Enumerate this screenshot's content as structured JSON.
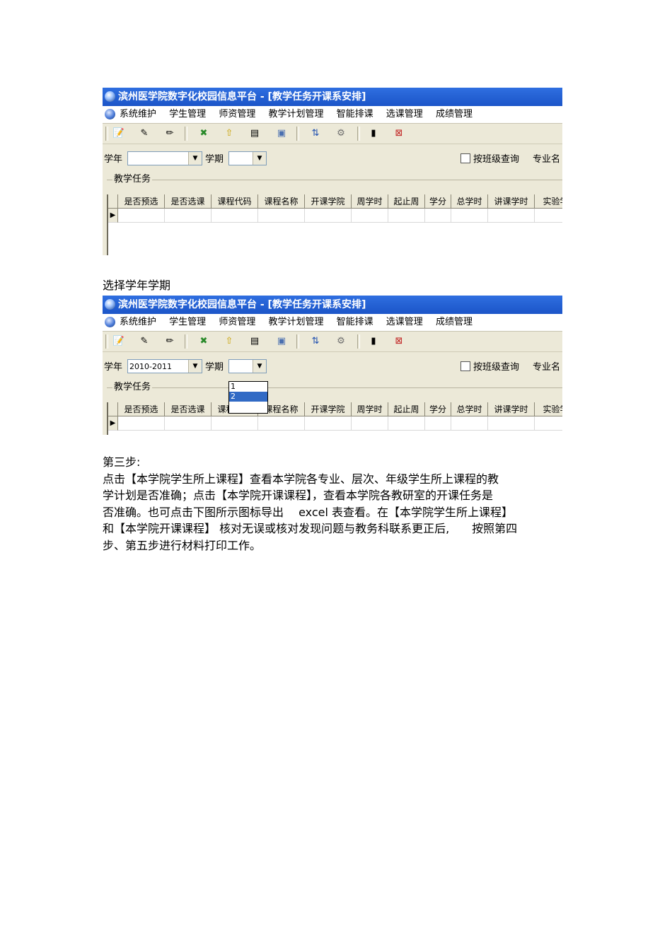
{
  "screenshot1": {
    "title": "滨州医学院数字化校园信息平台 - [教学任务开课系安排]",
    "menu": [
      "系统维护",
      "学生管理",
      "师资管理",
      "教学计划管理",
      "智能排课",
      "选课管理",
      "成绩管理"
    ],
    "filters": {
      "year_label": "学年",
      "year_value": "",
      "term_label": "学期",
      "term_value": "",
      "class_query_label": "按班级查询",
      "major_label": "专业名"
    },
    "group_label": "教学任务",
    "columns": [
      "是否预选",
      "是否选课",
      "课程代码",
      "课程名称",
      "开课学院",
      "周学时",
      "起止周",
      "学分",
      "总学时",
      "讲课学时",
      "实验学"
    ]
  },
  "caption": "选择学年学期",
  "screenshot2": {
    "title": "滨州医学院数字化校园信息平台 - [教学任务开课系安排]",
    "menu": [
      "系统维护",
      "学生管理",
      "师资管理",
      "教学计划管理",
      "智能排课",
      "选课管理",
      "成绩管理"
    ],
    "filters": {
      "year_label": "学年",
      "year_value": "2010-2011",
      "term_label": "学期",
      "term_value": "",
      "class_query_label": "按班级查询",
      "major_label": "专业名"
    },
    "term_options": [
      "1",
      "2"
    ],
    "term_selected": "2",
    "group_label": "教学任务",
    "columns": [
      "是否预选",
      "是否选课",
      "课程代码",
      "课程名称",
      "开课学院",
      "周学时",
      "起止周",
      "学分",
      "总学时",
      "讲课学时",
      "实验学"
    ]
  },
  "step": {
    "heading": "第三步:",
    "lines": [
      "点击【本学院学生所上课程】查看本学院各专业、层次、年级学生所上课程的教",
      "学计划是否准确；点击【本学院开课课程】，查看本学院各教研室的开课任务是",
      "否准确。也可点击下图所示图标导出　 excel 表查看。在【本学院学生所上课程】",
      "和【本学院开课课程】 核对无误或核对发现问题与教务科联系更正后,　　按照第四",
      "步、第五步进行材料打印工作。"
    ]
  },
  "toolbar_icons": [
    "new-record-icon",
    "edit-icon",
    "pencil-icon",
    "excel-export-icon",
    "upload-icon",
    "document-icon",
    "print-preview-icon",
    "filter-icon",
    "settings-icon",
    "save-icon",
    "delete-icon"
  ],
  "colors": {
    "titlebar": "#1b55c8",
    "selection": "#316ac5",
    "window_bg": "#ece9d8"
  }
}
